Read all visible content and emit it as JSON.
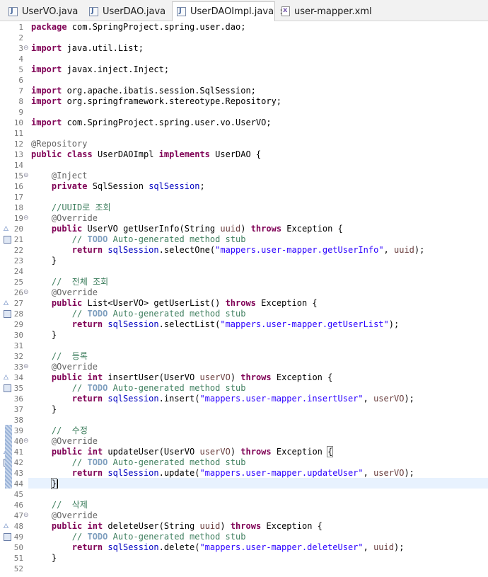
{
  "tabs": [
    {
      "label": "UserVO.java",
      "icon": "java-file-icon",
      "active": false
    },
    {
      "label": "UserDAO.java",
      "icon": "java-file-icon",
      "active": false
    },
    {
      "label": "UserDAOImpl.java",
      "icon": "java-file-icon",
      "active": true
    },
    {
      "label": "user-mapper.xml",
      "icon": "xml-file-icon",
      "active": false
    }
  ],
  "close_glyph": "✕",
  "editor": {
    "line_numbers": [
      "1",
      "2",
      "3",
      "4",
      "5",
      "6",
      "7",
      "8",
      "9",
      "10",
      "11",
      "12",
      "13",
      "14",
      "15",
      "16",
      "17",
      "18",
      "19",
      "20",
      "21",
      "22",
      "23",
      "24",
      "25",
      "26",
      "27",
      "28",
      "29",
      "30",
      "31",
      "32",
      "33",
      "34",
      "35",
      "36",
      "37",
      "38",
      "39",
      "40",
      "41",
      "42",
      "43",
      "44",
      "45",
      "46",
      "47",
      "48",
      "49",
      "50",
      "51",
      "52"
    ],
    "lines": {
      "l1_kw": "package",
      "l1_rest": " com.SpringProject.spring.user.dao;",
      "l3_kw": "import",
      "l3_rest": " java.util.List;",
      "l5_kw": "import",
      "l5_rest": " javax.inject.Inject;",
      "l7_kw": "import",
      "l7_rest": " org.apache.ibatis.session.SqlSession;",
      "l8_kw": "import",
      "l8_rest": " org.springframework.stereotype.Repository;",
      "l10_kw": "import",
      "l10_rest": " com.SpringProject.spring.user.vo.UserVO;",
      "l12_ann": "@Repository",
      "l13_kw1": "public",
      "l13_kw2": "class",
      "l13_name": " UserDAOImpl ",
      "l13_kw3": "implements",
      "l13_rest": " UserDAO {",
      "l15_ann": "@Inject",
      "l16_kw": "private",
      "l16_type": " SqlSession ",
      "l16_field": "sqlSession",
      "l16_end": ";",
      "l18_cm": "//UUID로 조회",
      "l19_ann": "@Override",
      "l20_kw": "public",
      "l20_a": " UserVO getUserInfo(String ",
      "l20_p": "uuid",
      "l20_b": ") ",
      "l20_kw2": "throws",
      "l20_c": " Exception {",
      "l21_cm": "// ",
      "l21_todo": "TODO",
      "l21_cm2": " Auto-generated method stub",
      "l22_kw": "return",
      "l22_field": " sqlSession",
      "l22_a": ".selectOne(",
      "l22_str": "\"mappers.user-mapper.getUserInfo\"",
      "l22_b": ", ",
      "l22_p": "uuid",
      "l22_c": ");",
      "l23": "}",
      "l25_cm": "//  전체 조회",
      "l26_ann": "@Override",
      "l27_kw": "public",
      "l27_a": " List<UserVO> getUserList() ",
      "l27_kw2": "throws",
      "l27_c": " Exception {",
      "l28_cm": "// ",
      "l28_todo": "TODO",
      "l28_cm2": " Auto-generated method stub",
      "l29_kw": "return",
      "l29_field": " sqlSession",
      "l29_a": ".selectList(",
      "l29_str": "\"mappers.user-mapper.getUserList\"",
      "l29_c": ");",
      "l30": "}",
      "l32_cm": "//  등록",
      "l33_ann": "@Override",
      "l34_kw": "public",
      "l34_kw2": "int",
      "l34_a": " insertUser(UserVO ",
      "l34_p": "userVO",
      "l34_b": ") ",
      "l34_kw3": "throws",
      "l34_c": " Exception {",
      "l35_cm": "// ",
      "l35_todo": "TODO",
      "l35_cm2": " Auto-generated method stub",
      "l36_kw": "return",
      "l36_field": " sqlSession",
      "l36_a": ".insert(",
      "l36_str": "\"mappers.user-mapper.insertUser\"",
      "l36_b": ", ",
      "l36_p": "userVO",
      "l36_c": ");",
      "l37": "}",
      "l39_cm": "//  수정",
      "l40_ann": "@Override",
      "l41_kw": "public",
      "l41_kw2": "int",
      "l41_a": " updateUser(UserVO ",
      "l41_p": "userVO",
      "l41_b": ") ",
      "l41_kw3": "throws",
      "l41_c": " Exception ",
      "l41_brace": "{",
      "l42_cm": "// ",
      "l42_todo": "TODO",
      "l42_cm2": " Auto-generated method stub",
      "l43_kw": "return",
      "l43_field": " sqlSession",
      "l43_a": ".update(",
      "l43_str": "\"mappers.user-mapper.updateUser\"",
      "l43_b": ", ",
      "l43_p": "userVO",
      "l43_c": ");",
      "l44": "}",
      "l46_cm": "//  삭제",
      "l47_ann": "@Override",
      "l48_kw": "public",
      "l48_kw2": "int",
      "l48_a": " deleteUser(String ",
      "l48_p": "uuid",
      "l48_b": ") ",
      "l48_kw3": "throws",
      "l48_c": " Exception {",
      "l49_cm": "// ",
      "l49_todo": "TODO",
      "l49_cm2": " Auto-generated method stub",
      "l50_kw": "return",
      "l50_field": " sqlSession",
      "l50_a": ".delete(",
      "l50_str": "\"mappers.user-mapper.deleteUser\"",
      "l50_b": ", ",
      "l50_p": "uuid",
      "l50_c": ");",
      "l51": "}"
    }
  },
  "fold_glyph": "⊖",
  "colors": {
    "keyword": "#7f0055",
    "string": "#2a00ff",
    "comment": "#3f7f5f",
    "field": "#0000c0",
    "annotation": "#646464",
    "current_line": "#e8f2fe"
  }
}
